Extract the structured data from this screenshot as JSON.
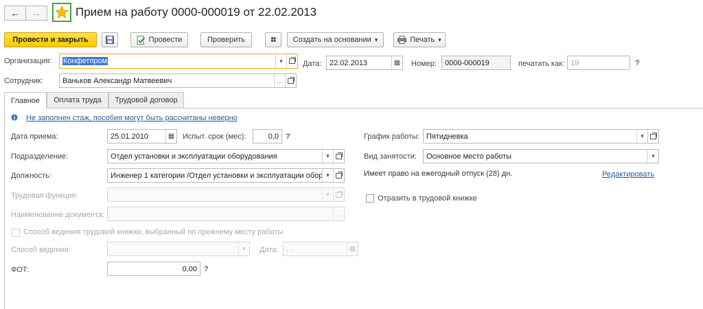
{
  "window": {
    "title": "Прием на работу 0000-000019 от 22.02.2013",
    "back_icon": "arrow-left",
    "forward_icon": "arrow-right",
    "star_icon": "star",
    "star_color": "#f2c400"
  },
  "toolbar": {
    "post_close": "Провести и закрыть",
    "save_icon": "floppy-disk",
    "post": "Провести",
    "check": "Проверить",
    "attach_icon": "paperclip",
    "create_based": "Создать на основании",
    "print": "Печать",
    "dropdown_arrow": "▾"
  },
  "header": {
    "org_label": "Организация:",
    "org_value": "Конфетпром",
    "date_label": "Дата:",
    "date_value": "22.02.2013",
    "number_label": "Номер:",
    "number_value": "0000-000019",
    "print_as_label": "печатать как:",
    "print_as_value": "19",
    "employee_label": "Сотрудник:",
    "employee_value": "Ваньков Александр Матвеевич"
  },
  "tabs": [
    {
      "label": "Главное"
    },
    {
      "label": "Оплата труда"
    },
    {
      "label": "Трудовой договор"
    }
  ],
  "main": {
    "warning_link": "Не заполнен стаж, пособия могут быть рассчитаны неверно",
    "hire_date_label": "Дата приема:",
    "hire_date_value": "25.01.2010",
    "trial_label": "Испыт. срок (мес):",
    "trial_value": "0,0",
    "division_label": "Подразделение:",
    "division_value": "Отдел установки и эксплуатации оборудования",
    "position_label": "Должность:",
    "position_value": "Инженер 1 категории /Отдел установки и эксплуатации обор",
    "labor_function_label": "Трудовая функция:",
    "doc_name_label": "Наименование документа:",
    "workbook_method_label": "Способ ведения трудовой книжки, выбранный по прежнему месту работы",
    "method_label": "Способ ведения:",
    "date2_label": "Дата:",
    "date2_value": " .  .",
    "fot_label": "ФОТ:",
    "fot_value": "0,00",
    "schedule_label": "График работы:",
    "schedule_value": "Пятидневка",
    "employment_label": "Вид занятости:",
    "employment_value": "Основное место работы",
    "vacation_text": "Имеет право на ежегодный отпуск (28) дн.",
    "edit_link": "Редактировать",
    "reflect_label": "Отразить в трудовой книжке",
    "help_mark": "?"
  }
}
